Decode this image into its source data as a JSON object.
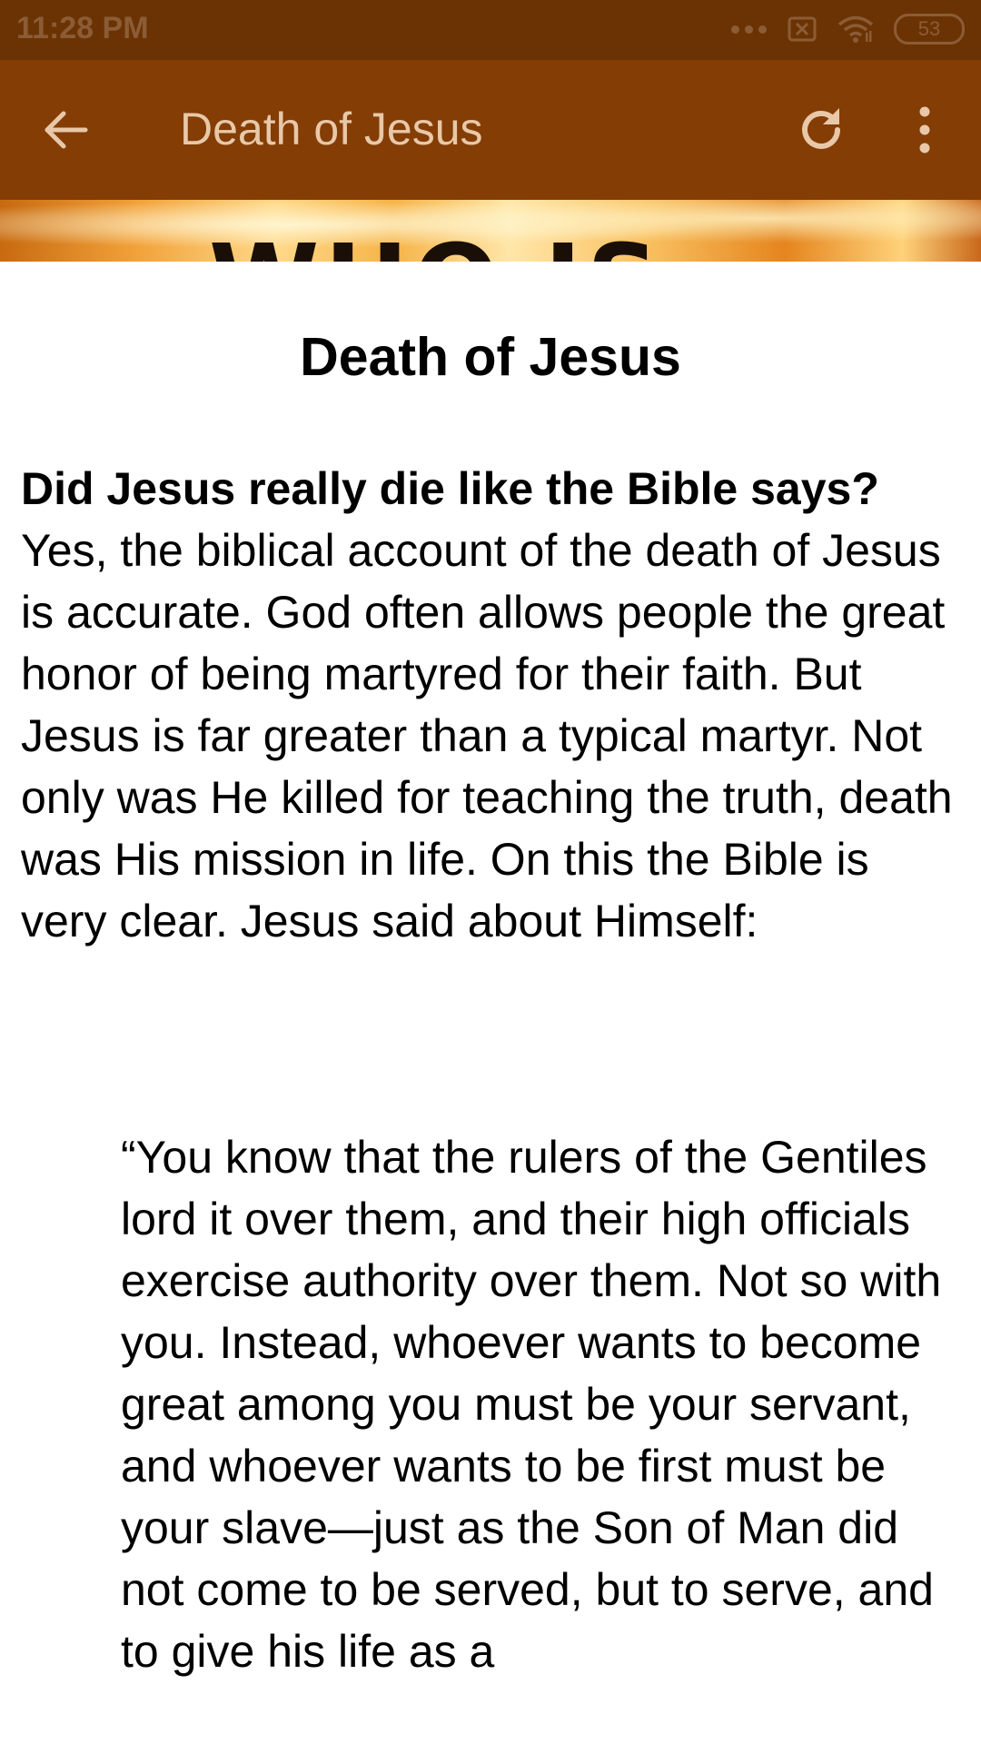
{
  "status_bar": {
    "time": "11:28 PM",
    "battery": "53"
  },
  "app_bar": {
    "title": "Death of Jesus"
  },
  "banner": {
    "text": "WHO IS"
  },
  "article": {
    "title": "Death of Jesus",
    "question": "Did Jesus really die like the Bible says?",
    "paragraph": "Yes, the biblical account of the death of Jesus is accurate. God often allows people the great honor of being martyred for their faith. But Jesus is far greater than a typical martyr. Not only was He killed for teaching the truth, death was His mission in life. On this the Bible is very clear. Jesus said about Himself:",
    "quote": "“You know that the rulers of the Gentiles lord it over them, and their high officials exercise authority over them. Not so with you. Instead, whoever wants to become great among you must be your servant, and whoever wants to be first must be your slave—just as the Son of Man did not come to be served, but to serve, and to give his life as a"
  },
  "colors": {
    "status_bar": "#6b3304",
    "app_bar": "#833d05",
    "app_title": "#e8c8a8",
    "icon": "#e8c8a8"
  },
  "icons": {
    "back": "arrow-left",
    "refresh": "refresh",
    "more": "more-vertical",
    "wifi": "wifi",
    "sim": "no-sim",
    "dots": "more-horizontal"
  }
}
